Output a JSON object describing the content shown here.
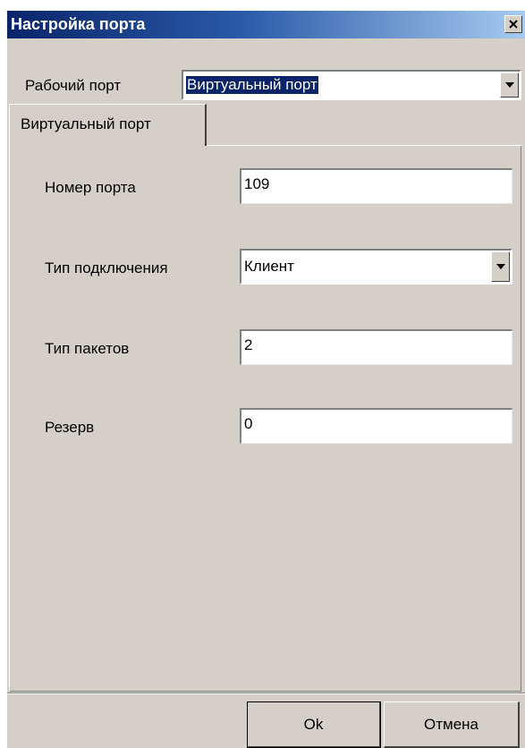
{
  "window": {
    "title": "Настройка порта"
  },
  "work_port": {
    "label": "Рабочий порт",
    "value": "Виртуальный порт"
  },
  "tabs": [
    {
      "label": "Виртуальный порт",
      "active": true
    }
  ],
  "form": {
    "port_number": {
      "label": "Номер порта",
      "value": "109"
    },
    "connection_type": {
      "label": "Тип подключения",
      "value": "Клиент"
    },
    "packet_type": {
      "label": "Тип пакетов",
      "value": "2"
    },
    "reserve": {
      "label": "Резерв",
      "value": "0"
    }
  },
  "buttons": {
    "ok": "Ok",
    "cancel": "Отмена"
  },
  "colors": {
    "face": "#d4d0c8",
    "title_start": "#0a246a",
    "title_end": "#a6caf0",
    "selection": "#0a246a"
  },
  "icons": {
    "close": "close-icon",
    "dropdown": "chevron-down-icon"
  }
}
